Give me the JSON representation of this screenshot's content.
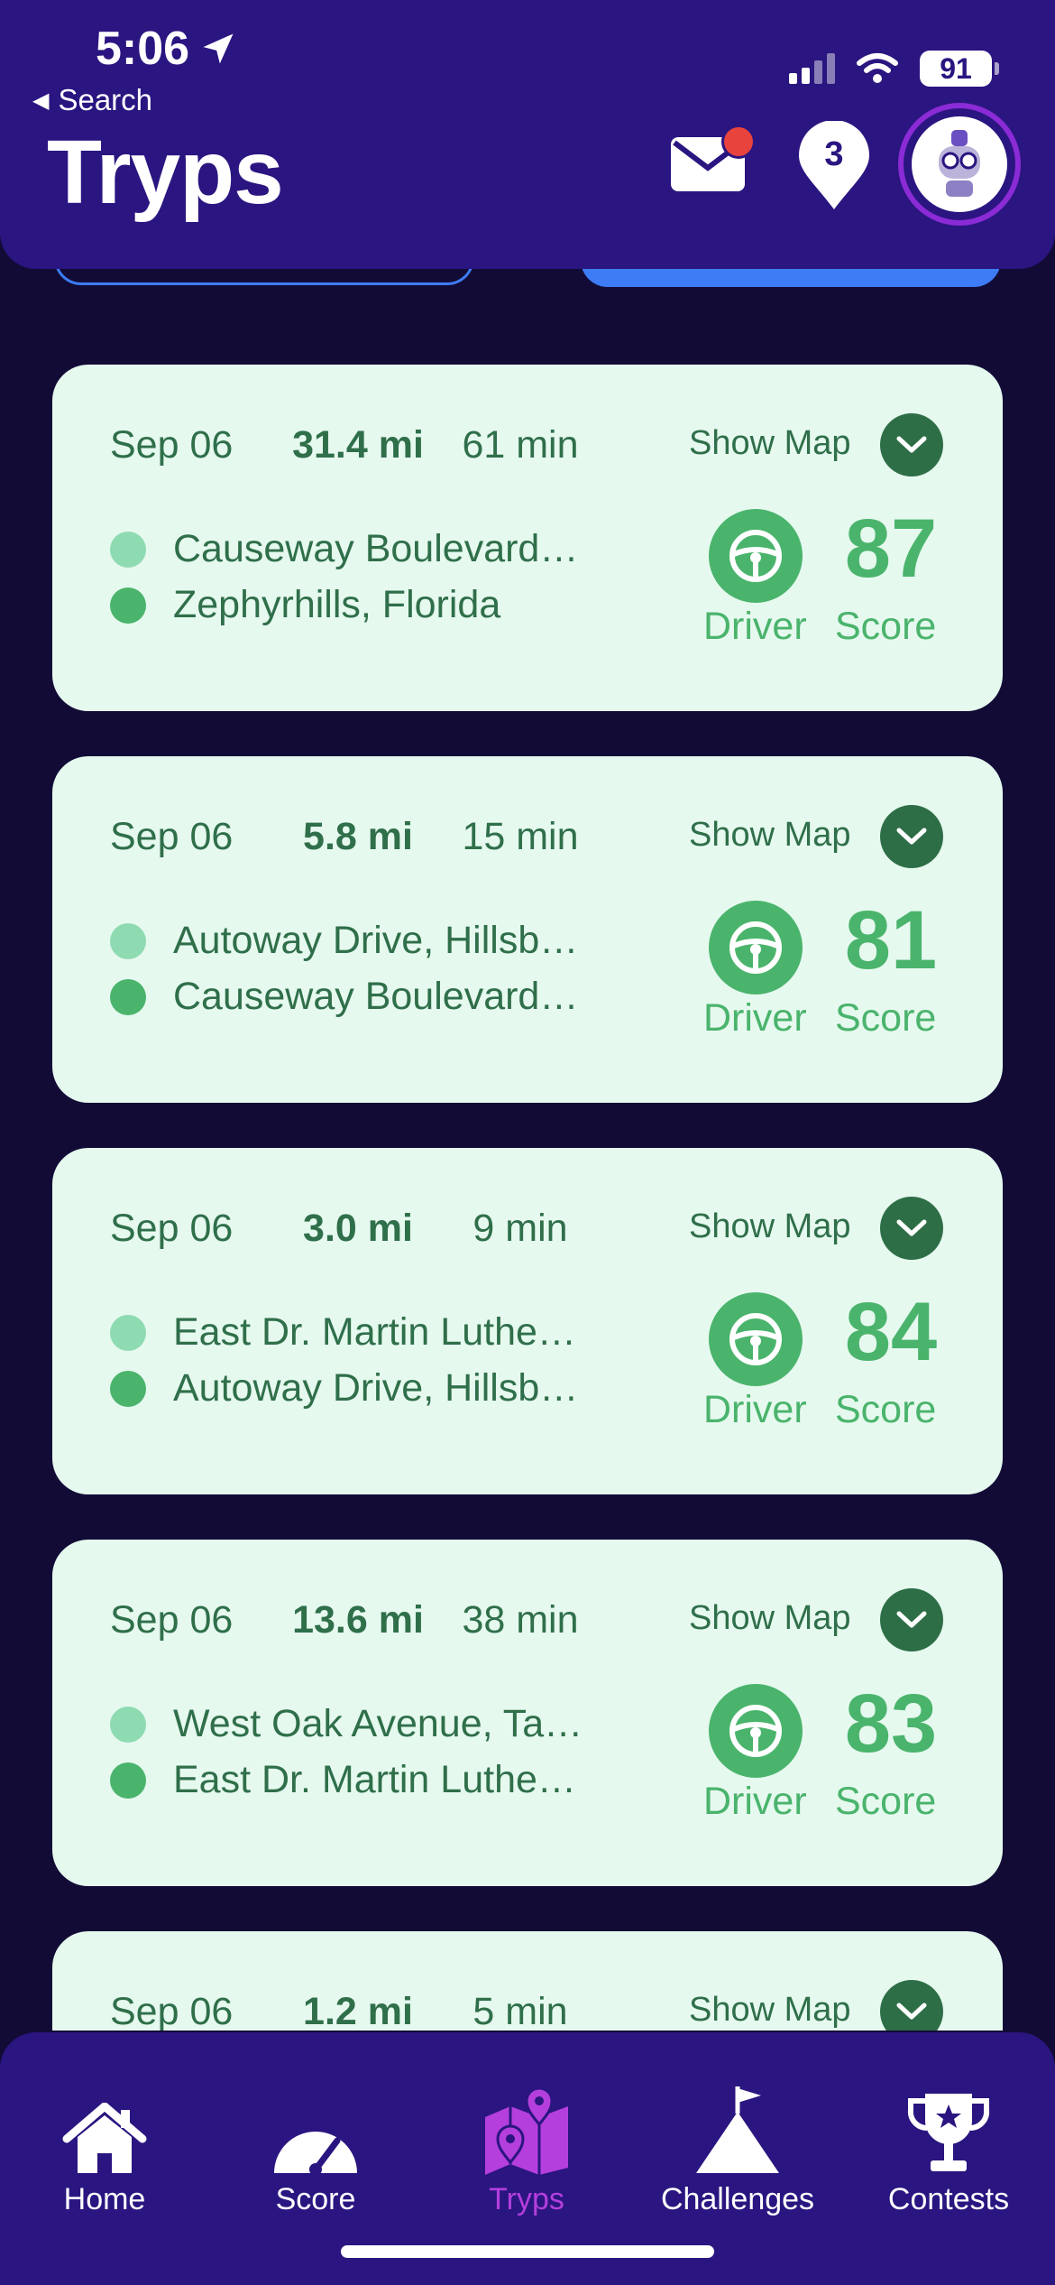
{
  "status_bar": {
    "time": "5:06",
    "back_label": "Search",
    "battery": "91"
  },
  "header": {
    "title": "Tryps",
    "notification_count": "3"
  },
  "show_map_label": "Show Map",
  "driver_label": "Driver",
  "score_label": "Score",
  "trips": [
    {
      "date": "Sep 06",
      "distance": "31.4 mi",
      "duration": "61 min",
      "start": "Causeway Boulevard…",
      "end": "Zephyrhills, Florida",
      "score": "87"
    },
    {
      "date": "Sep 06",
      "distance": "5.8 mi",
      "duration": "15 min",
      "start": "Autoway Drive, Hillsb…",
      "end": "Causeway Boulevard…",
      "score": "81"
    },
    {
      "date": "Sep 06",
      "distance": "3.0 mi",
      "duration": "9 min",
      "start": "East Dr. Martin Luthe…",
      "end": "Autoway Drive, Hillsb…",
      "score": "84"
    },
    {
      "date": "Sep 06",
      "distance": "13.6 mi",
      "duration": "38 min",
      "start": "West Oak Avenue, Ta…",
      "end": "East Dr. Martin Luthe…",
      "score": "83"
    },
    {
      "date": "Sep 06",
      "distance": "1.2 mi",
      "duration": "5 min",
      "start": "",
      "end": "",
      "score": ""
    }
  ],
  "nav": [
    {
      "label": "Home",
      "icon": "home-icon"
    },
    {
      "label": "Score",
      "icon": "speedometer-icon"
    },
    {
      "label": "Tryps",
      "icon": "map-icon",
      "active": true
    },
    {
      "label": "Challenges",
      "icon": "mountain-flag-icon"
    },
    {
      "label": "Contests",
      "icon": "trophy-icon"
    }
  ],
  "colors": {
    "header_bg": "#2b1580",
    "page_bg": "#120b36",
    "card_bg": "#e6f9ef",
    "score_green": "#4ab46c",
    "text_green": "#2f6f4a",
    "active_purple": "#b43fdd",
    "accent_blue": "#3d7cf5",
    "badge_red": "#e8433d"
  }
}
